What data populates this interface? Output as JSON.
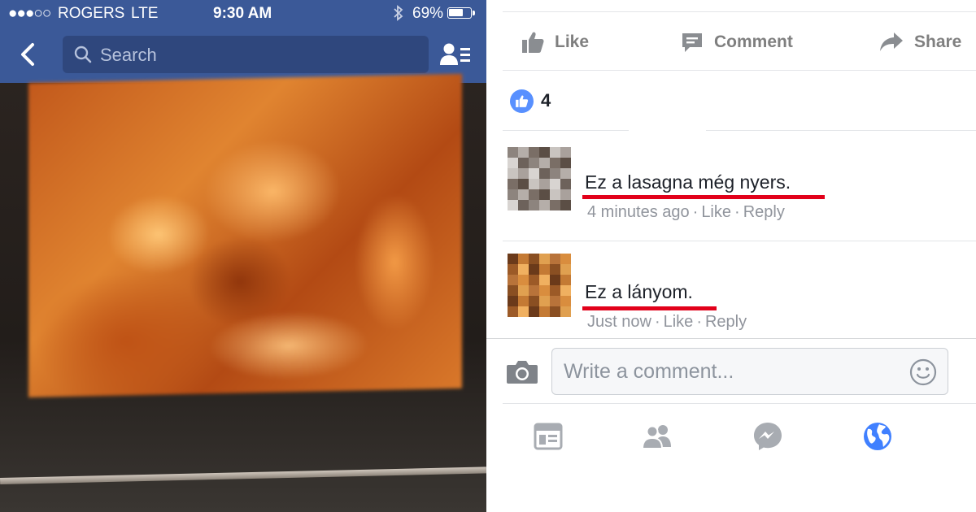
{
  "status_bar": {
    "signal": "●●●○○",
    "carrier": "ROGERS",
    "network": "LTE",
    "time": "9:30 AM",
    "bluetooth_icon": "bluetooth-icon",
    "battery_percent": "69%",
    "battery_level": 0.69
  },
  "nav": {
    "back_icon": "chevron-left-icon",
    "search_placeholder": "Search",
    "friends_icon": "friend-requests-icon",
    "bar_color": "#3b5998"
  },
  "actions": {
    "like": "Like",
    "comment": "Comment",
    "share": "Share"
  },
  "reactions": {
    "count": "4",
    "icon": "like-badge-icon"
  },
  "comments": [
    {
      "text": "Ez a lasagna még nyers.",
      "time": "4 minutes ago",
      "like": "Like",
      "reply": "Reply"
    },
    {
      "text": "Ez a lányom.",
      "time": "Just now",
      "like": "Like",
      "reply": "Reply"
    }
  ],
  "composer": {
    "placeholder": "Write a comment...",
    "camera_icon": "camera-icon",
    "emoji_icon": "smiley-icon"
  },
  "tabbar": {
    "items": [
      "news-feed-icon",
      "friends-icon",
      "messenger-icon",
      "globe-notifications-icon"
    ],
    "active_color": "#4080ff",
    "highlight_color": "#e2001a"
  }
}
